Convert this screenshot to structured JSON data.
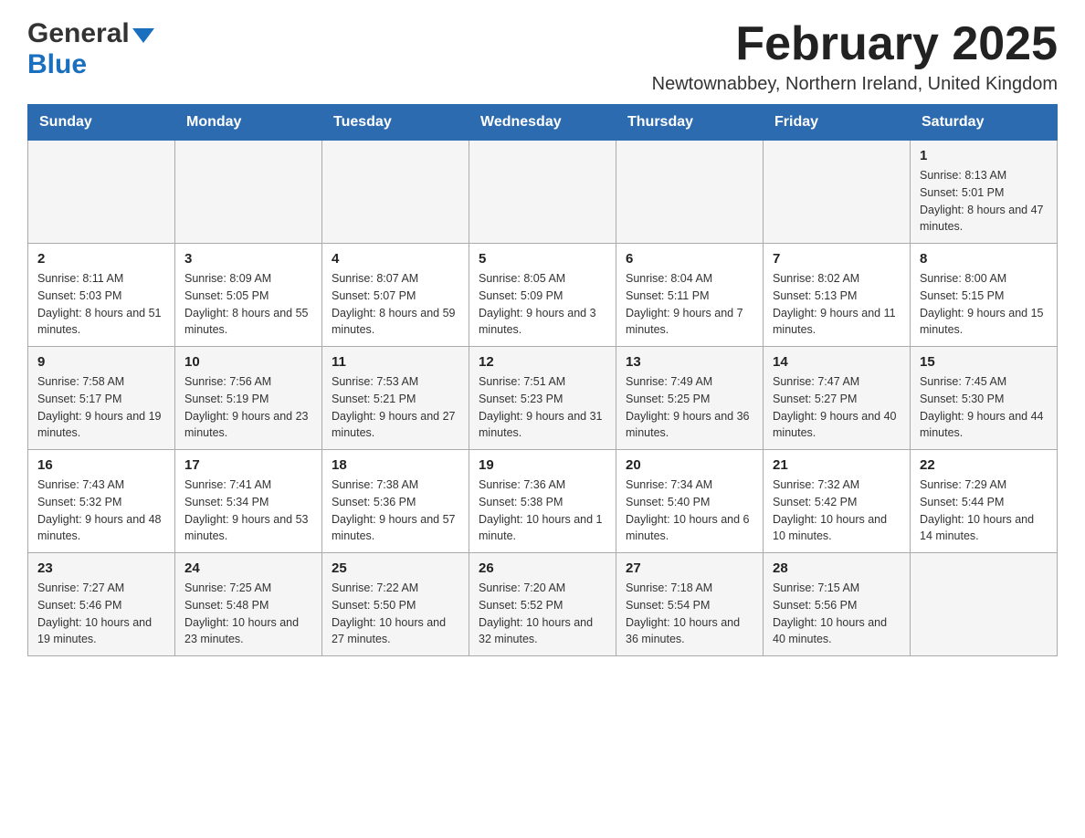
{
  "header": {
    "logo_general": "General",
    "logo_blue": "Blue",
    "month_title": "February 2025",
    "location": "Newtownabbey, Northern Ireland, United Kingdom"
  },
  "weekdays": [
    "Sunday",
    "Monday",
    "Tuesday",
    "Wednesday",
    "Thursday",
    "Friday",
    "Saturday"
  ],
  "weeks": [
    {
      "days": [
        {
          "number": "",
          "info": ""
        },
        {
          "number": "",
          "info": ""
        },
        {
          "number": "",
          "info": ""
        },
        {
          "number": "",
          "info": ""
        },
        {
          "number": "",
          "info": ""
        },
        {
          "number": "",
          "info": ""
        },
        {
          "number": "1",
          "info": "Sunrise: 8:13 AM\nSunset: 5:01 PM\nDaylight: 8 hours and 47 minutes."
        }
      ]
    },
    {
      "days": [
        {
          "number": "2",
          "info": "Sunrise: 8:11 AM\nSunset: 5:03 PM\nDaylight: 8 hours and 51 minutes."
        },
        {
          "number": "3",
          "info": "Sunrise: 8:09 AM\nSunset: 5:05 PM\nDaylight: 8 hours and 55 minutes."
        },
        {
          "number": "4",
          "info": "Sunrise: 8:07 AM\nSunset: 5:07 PM\nDaylight: 8 hours and 59 minutes."
        },
        {
          "number": "5",
          "info": "Sunrise: 8:05 AM\nSunset: 5:09 PM\nDaylight: 9 hours and 3 minutes."
        },
        {
          "number": "6",
          "info": "Sunrise: 8:04 AM\nSunset: 5:11 PM\nDaylight: 9 hours and 7 minutes."
        },
        {
          "number": "7",
          "info": "Sunrise: 8:02 AM\nSunset: 5:13 PM\nDaylight: 9 hours and 11 minutes."
        },
        {
          "number": "8",
          "info": "Sunrise: 8:00 AM\nSunset: 5:15 PM\nDaylight: 9 hours and 15 minutes."
        }
      ]
    },
    {
      "days": [
        {
          "number": "9",
          "info": "Sunrise: 7:58 AM\nSunset: 5:17 PM\nDaylight: 9 hours and 19 minutes."
        },
        {
          "number": "10",
          "info": "Sunrise: 7:56 AM\nSunset: 5:19 PM\nDaylight: 9 hours and 23 minutes."
        },
        {
          "number": "11",
          "info": "Sunrise: 7:53 AM\nSunset: 5:21 PM\nDaylight: 9 hours and 27 minutes."
        },
        {
          "number": "12",
          "info": "Sunrise: 7:51 AM\nSunset: 5:23 PM\nDaylight: 9 hours and 31 minutes."
        },
        {
          "number": "13",
          "info": "Sunrise: 7:49 AM\nSunset: 5:25 PM\nDaylight: 9 hours and 36 minutes."
        },
        {
          "number": "14",
          "info": "Sunrise: 7:47 AM\nSunset: 5:27 PM\nDaylight: 9 hours and 40 minutes."
        },
        {
          "number": "15",
          "info": "Sunrise: 7:45 AM\nSunset: 5:30 PM\nDaylight: 9 hours and 44 minutes."
        }
      ]
    },
    {
      "days": [
        {
          "number": "16",
          "info": "Sunrise: 7:43 AM\nSunset: 5:32 PM\nDaylight: 9 hours and 48 minutes."
        },
        {
          "number": "17",
          "info": "Sunrise: 7:41 AM\nSunset: 5:34 PM\nDaylight: 9 hours and 53 minutes."
        },
        {
          "number": "18",
          "info": "Sunrise: 7:38 AM\nSunset: 5:36 PM\nDaylight: 9 hours and 57 minutes."
        },
        {
          "number": "19",
          "info": "Sunrise: 7:36 AM\nSunset: 5:38 PM\nDaylight: 10 hours and 1 minute."
        },
        {
          "number": "20",
          "info": "Sunrise: 7:34 AM\nSunset: 5:40 PM\nDaylight: 10 hours and 6 minutes."
        },
        {
          "number": "21",
          "info": "Sunrise: 7:32 AM\nSunset: 5:42 PM\nDaylight: 10 hours and 10 minutes."
        },
        {
          "number": "22",
          "info": "Sunrise: 7:29 AM\nSunset: 5:44 PM\nDaylight: 10 hours and 14 minutes."
        }
      ]
    },
    {
      "days": [
        {
          "number": "23",
          "info": "Sunrise: 7:27 AM\nSunset: 5:46 PM\nDaylight: 10 hours and 19 minutes."
        },
        {
          "number": "24",
          "info": "Sunrise: 7:25 AM\nSunset: 5:48 PM\nDaylight: 10 hours and 23 minutes."
        },
        {
          "number": "25",
          "info": "Sunrise: 7:22 AM\nSunset: 5:50 PM\nDaylight: 10 hours and 27 minutes."
        },
        {
          "number": "26",
          "info": "Sunrise: 7:20 AM\nSunset: 5:52 PM\nDaylight: 10 hours and 32 minutes."
        },
        {
          "number": "27",
          "info": "Sunrise: 7:18 AM\nSunset: 5:54 PM\nDaylight: 10 hours and 36 minutes."
        },
        {
          "number": "28",
          "info": "Sunrise: 7:15 AM\nSunset: 5:56 PM\nDaylight: 10 hours and 40 minutes."
        },
        {
          "number": "",
          "info": ""
        }
      ]
    }
  ]
}
